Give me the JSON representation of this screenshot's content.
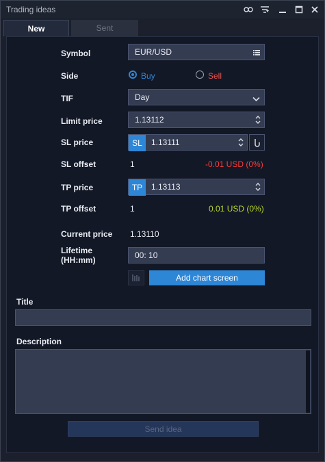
{
  "window": {
    "title": "Trading ideas"
  },
  "tabs": [
    {
      "label": "New",
      "active": true
    },
    {
      "label": "Sent",
      "active": false
    }
  ],
  "form": {
    "symbol": {
      "label": "Symbol",
      "value": "EUR/USD"
    },
    "side": {
      "label": "Side",
      "buy_label": "Buy",
      "sell_label": "Sell",
      "selected": "Buy"
    },
    "tif": {
      "label": "TIF",
      "value": "Day"
    },
    "limit_price": {
      "label": "Limit price",
      "value": "1.13112"
    },
    "sl_price": {
      "label": "SL price",
      "badge": "SL",
      "value": "1.13111"
    },
    "sl_offset": {
      "label": "SL offset",
      "value": "1",
      "pnl": "-0.01 USD (0%)"
    },
    "tp_price": {
      "label": "TP price",
      "badge": "TP",
      "value": "1.13113"
    },
    "tp_offset": {
      "label": "TP offset",
      "value": "1",
      "pnl": "0.01 USD (0%)"
    },
    "current_price": {
      "label": "Current price",
      "value": "1.13110"
    },
    "lifetime": {
      "label_line1": "Lifetime",
      "label_line2": "(HH:mm)",
      "value": "00: 10"
    },
    "add_chart_screen_label": "Add chart screen",
    "title_label": "Title",
    "title_value": "",
    "description_label": "Description",
    "description_value": "",
    "send_label": "Send idea"
  },
  "colors": {
    "accent": "#2e86d6",
    "sell": "#e8504b",
    "negative": "#ff3b3b",
    "positive": "#b7d432"
  },
  "icons": [
    "link-icon",
    "filter-icon",
    "minimize-icon",
    "maximize-icon",
    "close-icon",
    "list-icon",
    "chevron-down-icon",
    "spinner-icon",
    "hook-icon",
    "chart-screen-icon"
  ]
}
